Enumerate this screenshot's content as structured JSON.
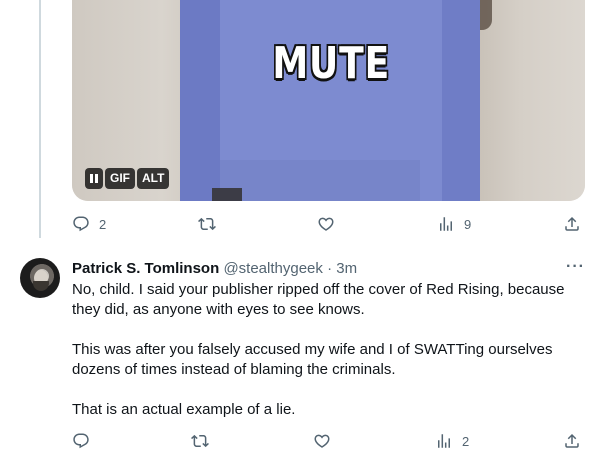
{
  "first_tweet": {
    "media": {
      "caption_text": "MUTE",
      "badges": {
        "pause": "",
        "gif": "GIF",
        "alt": "ALT"
      }
    },
    "actions": {
      "replies": "2",
      "retweets": "",
      "likes": "",
      "views": "9"
    }
  },
  "reply_tweet": {
    "display_name": "Patrick S. Tomlinson",
    "handle": "@stealthygeek",
    "separator": "·",
    "time": "3m",
    "more": "···",
    "paragraphs": [
      "No, child. I said your publisher ripped off the cover of Red Rising, because they did, as anyone with eyes to see knows.",
      "This was after you falsely accused my wife and I of SWATTing ourselves dozens of times instead of blaming the criminals.",
      "That is an actual example of a lie."
    ],
    "actions": {
      "replies": "",
      "retweets": "",
      "likes": "",
      "views": "2"
    }
  },
  "icons": [
    "reply-icon",
    "retweet-icon",
    "like-icon",
    "views-icon",
    "share-icon",
    "pause-icon",
    "more-icon"
  ],
  "colors": {
    "muted_text": "#536471",
    "primary_text": "#0f1419",
    "thread_line": "#cfd9de",
    "shirt": "#7d8bd0"
  }
}
